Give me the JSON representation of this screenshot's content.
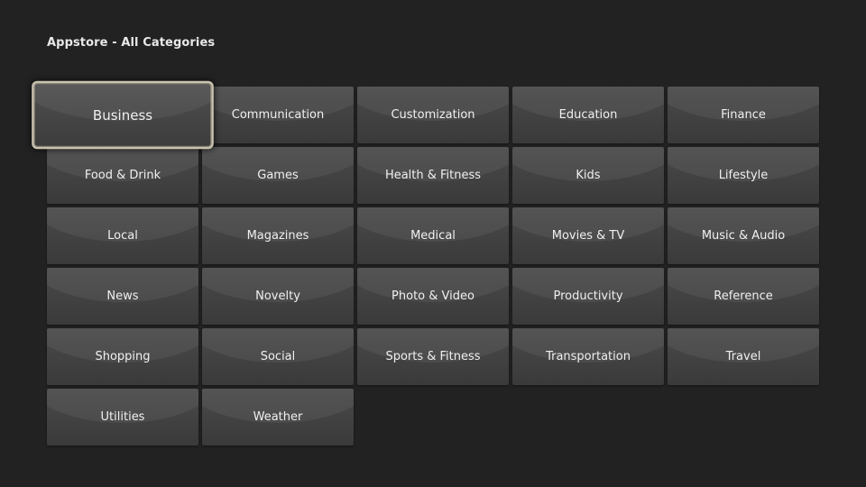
{
  "header": {
    "title": "Appstore - All Categories"
  },
  "focused_category": "Business",
  "categories": [
    "Business",
    "Communication",
    "Customization",
    "Education",
    "Finance",
    "Food & Drink",
    "Games",
    "Health & Fitness",
    "Kids",
    "Lifestyle",
    "Local",
    "Magazines",
    "Medical",
    "Movies & TV",
    "Music & Audio",
    "News",
    "Novelty",
    "Photo & Video",
    "Productivity",
    "Reference",
    "Shopping",
    "Social",
    "Sports & Fitness",
    "Transportation",
    "Travel",
    "Utilities",
    "Weather"
  ]
}
